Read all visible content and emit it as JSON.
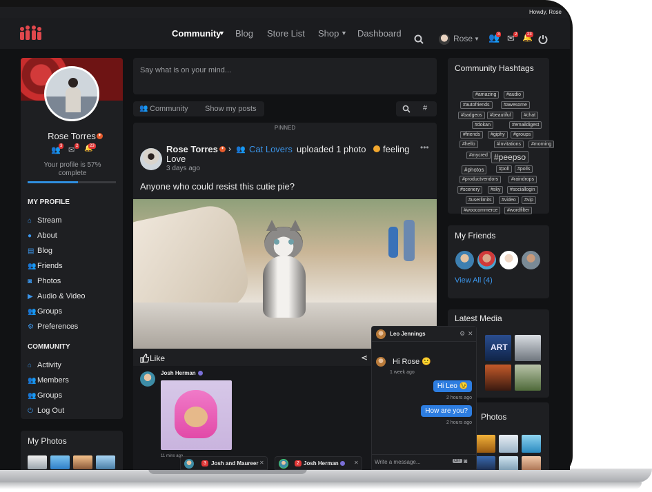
{
  "adminbar": {
    "howdy": "Howdy, Rose"
  },
  "nav": {
    "community": "Community",
    "blog": "Blog",
    "store_list": "Store List",
    "shop": "Shop",
    "dashboard": "Dashboard",
    "user": "Rose",
    "badges": {
      "friends": "3",
      "messages": "2",
      "notifications": "23"
    }
  },
  "profile": {
    "name": "Rose Torres",
    "badges": {
      "friends": "3",
      "messages": "2",
      "notifications": "23"
    },
    "completion": "Your profile is 57% complete",
    "completion_value": 0.57
  },
  "sidebar": {
    "my_profile_heading": "MY PROFILE",
    "my_profile_items": [
      "Stream",
      "About",
      "Blog",
      "Friends",
      "Photos",
      "Audio & Video",
      "Groups",
      "Preferences"
    ],
    "community_heading": "COMMUNITY",
    "community_items": [
      "Activity",
      "Members",
      "Groups",
      "Log Out"
    ],
    "my_photos_title": "My Photos"
  },
  "composer": {
    "placeholder": "Say what is on your mind..."
  },
  "filters": {
    "community": "Community",
    "show_my_posts": "Show my posts"
  },
  "post": {
    "pinned": "PINNED",
    "author": "Rose Torres",
    "group": "Cat Lovers",
    "action_pre": "uploaded 1 photo",
    "action_post": "feeling",
    "action_line2": "Love",
    "time": "3 days ago",
    "text": "Anyone who could resist this cutie pie?",
    "like": "Like",
    "comment_author": "Josh Herman",
    "comment_time": "11 mins ago"
  },
  "hashtags": {
    "title": "Community Hashtags",
    "tags": [
      "#amazing",
      "#audio",
      "#autofriends",
      "#awesome",
      "#badgeos",
      "#beautiful",
      "#chat",
      "#dokan",
      "#emaildigest",
      "#friends",
      "#giphy",
      "#groups",
      "#hello",
      "#invitations",
      "#morning",
      "#mycred",
      "#peepso",
      "#photos",
      "#poll",
      "#polls",
      "#productvendors",
      "#raindrops",
      "#scenery",
      "#sky",
      "#sociallogin",
      "#userlimits",
      "#video",
      "#vip",
      "#woocommerce",
      "#wordfilter"
    ]
  },
  "friends": {
    "title": "My Friends",
    "view_all": "View All (4)"
  },
  "media": {
    "title": "Latest Media",
    "photos_title": "Photos",
    "art_label": "ART"
  },
  "chat": {
    "name": "Leo Jennings",
    "incoming": "Hi Rose 🙂",
    "incoming_time": "1 week ago",
    "out1": "Hi Leo 😉",
    "out1_time": "2 hours ago",
    "out2": "How are you?",
    "out2_time": "2 hours ago",
    "placeholder": "Write a message...",
    "gif": "GIF"
  },
  "chat_tabs": [
    {
      "name": "Josh and Maureer",
      "count": "3"
    },
    {
      "name": "Josh Herman",
      "count": "2"
    }
  ],
  "colors": {
    "accent": "#2f8fe0",
    "badge": "#e03535",
    "bubble": "#2d7de0",
    "background": "#111214",
    "card": "#1e1f22"
  }
}
